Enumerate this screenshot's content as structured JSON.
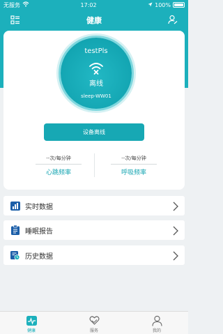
{
  "status_bar": {
    "carrier": "无服务",
    "time": "17:02",
    "battery": "100%"
  },
  "header": {
    "title": "健康"
  },
  "device": {
    "name": "testPls",
    "status": "离线",
    "id": "sleep-WW01",
    "offline_button": "设备离线"
  },
  "metrics": {
    "heart_rate": {
      "value": "--次/每分钟",
      "label": "心跳频率"
    },
    "resp_rate": {
      "value": "--次/每分钟",
      "label": "呼吸频率"
    }
  },
  "menu": [
    {
      "label": "实时数据",
      "icon": "bar-chart-icon"
    },
    {
      "label": "睡眠报告",
      "icon": "clipboard-icon"
    },
    {
      "label": "历史数据",
      "icon": "history-list-icon"
    }
  ],
  "tabs": [
    {
      "label": "健康",
      "icon": "monitor-pulse-icon",
      "active": true
    },
    {
      "label": "服务",
      "icon": "heart-hand-icon",
      "active": false
    },
    {
      "label": "我的",
      "icon": "person-icon",
      "active": false
    }
  ],
  "colors": {
    "primary": "#1cb0bc",
    "background": "#eef1f3"
  }
}
